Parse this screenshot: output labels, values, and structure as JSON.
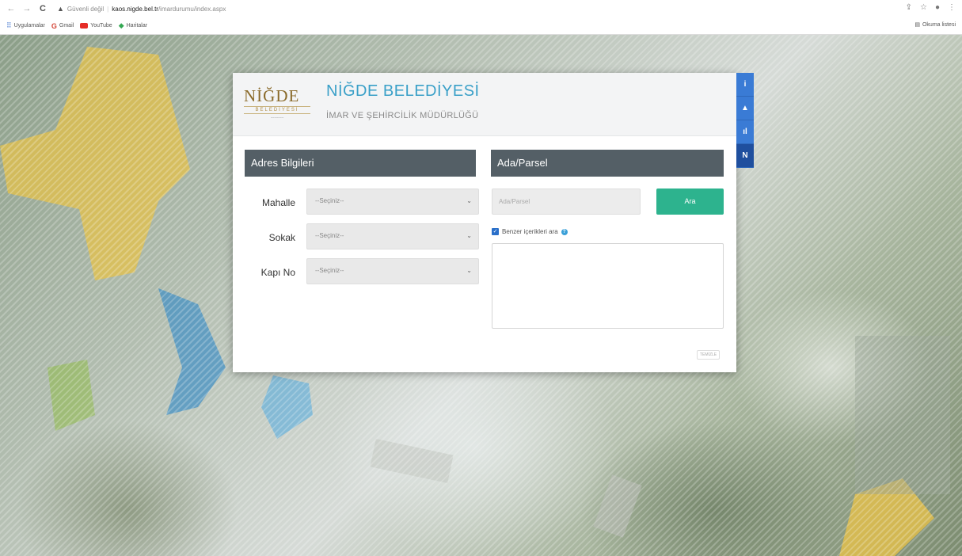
{
  "browser": {
    "nav": {
      "back": "←",
      "forward": "→",
      "reload": "C"
    },
    "security": "Güvenli değil",
    "url_host": "kaos.nigde.bel.tr",
    "url_path": "/imardurumu/index.aspx",
    "right_icons": [
      "share-icon",
      "star-icon",
      "profile-icon",
      "menu-icon"
    ],
    "bookmarks": [
      {
        "label": "Uygulamalar",
        "icon": "apps-icon"
      },
      {
        "label": "Gmail",
        "icon": "gmail-icon"
      },
      {
        "label": "YouTube",
        "icon": "youtube-icon"
      },
      {
        "label": "Haritalar",
        "icon": "maps-icon"
      }
    ],
    "reading_list": "Okuma listesi"
  },
  "header": {
    "logo_word": "NİĞDE",
    "logo_sub": "BELEDİYESİ",
    "title": "NİĞDE BELEDİYESİ",
    "subtitle": "İMAR VE ŞEHİRCİLİK MÜDÜRLÜĞÜ"
  },
  "address": {
    "section_title": "Adres Bilgileri",
    "fields": [
      {
        "label": "Mahalle",
        "value": "--Seçiniz--"
      },
      {
        "label": "Sokak",
        "value": "--Seçiniz--"
      },
      {
        "label": "Kapı No",
        "value": "--Seçiniz--"
      }
    ]
  },
  "parcel": {
    "section_title": "Ada/Parsel",
    "input_placeholder": "Ada/Parsel",
    "search_button": "Ara",
    "similar_label": "Benzer içerikleri ara",
    "clear_button": "TEMİZLE"
  },
  "colors": {
    "accent_green": "#2db38e",
    "section_bar": "#545f66",
    "brand_blue": "#3aa0c8",
    "tool_blue": "#3a7bd5"
  },
  "side_tools": [
    {
      "icon": "info-icon",
      "glyph": "i"
    },
    {
      "icon": "warning-icon",
      "glyph": "▲"
    },
    {
      "icon": "stats-icon",
      "glyph": "ıl"
    },
    {
      "icon": "map-pin-icon",
      "glyph": "N"
    }
  ]
}
